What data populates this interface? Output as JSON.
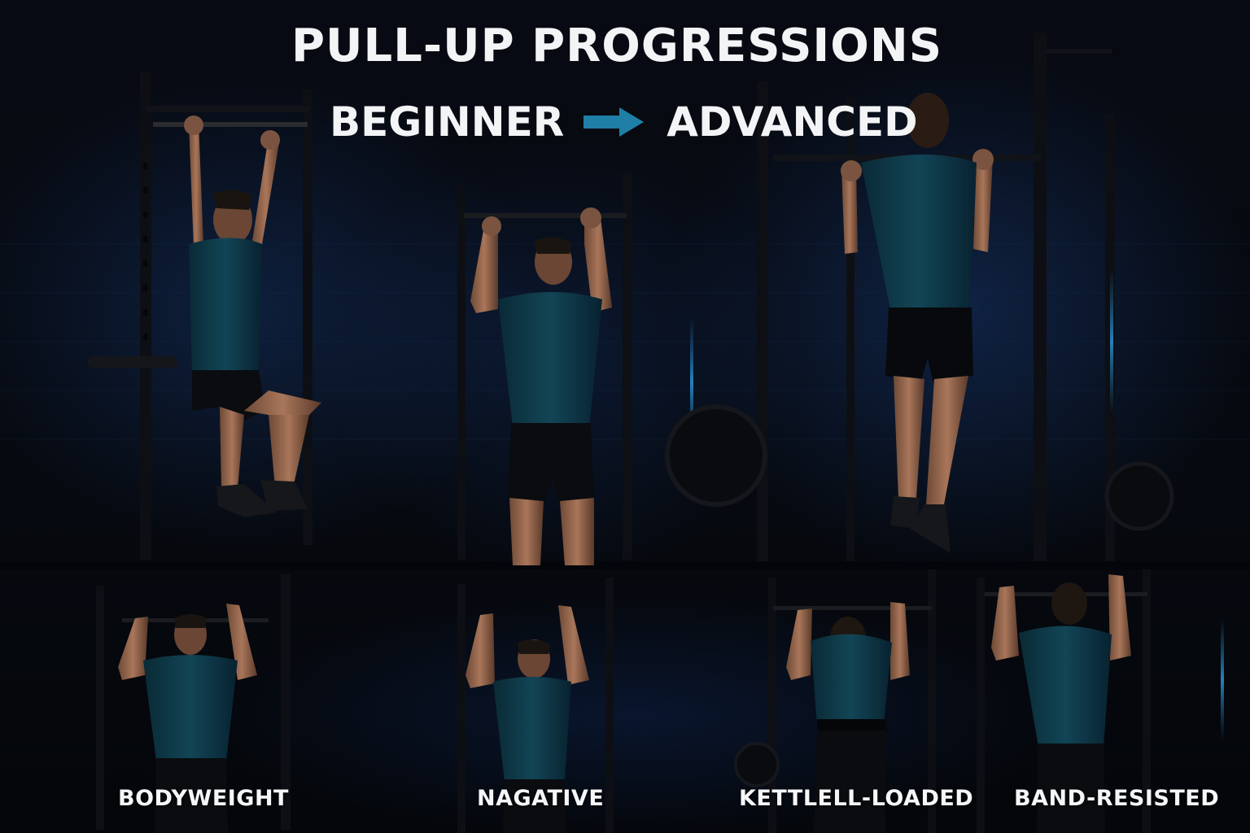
{
  "header": {
    "title": "PULL-UP PROGRESSIONS",
    "from_label": "BEGINNER",
    "to_label": "ADVANCED",
    "arrow_icon": "arrow-right-icon",
    "arrow_color": "#1f7fa6"
  },
  "panels": [
    {
      "label": "BODYWEIGHT"
    },
    {
      "label": "NAGATIVE"
    },
    {
      "label": "KETTLELL-LOADED"
    },
    {
      "label": "BAND-RESISTED"
    }
  ],
  "colors": {
    "background": "#05070c",
    "shirt": "#0f3a48",
    "accent_light": "#1e6fa0",
    "text": "#f2f4f6"
  }
}
